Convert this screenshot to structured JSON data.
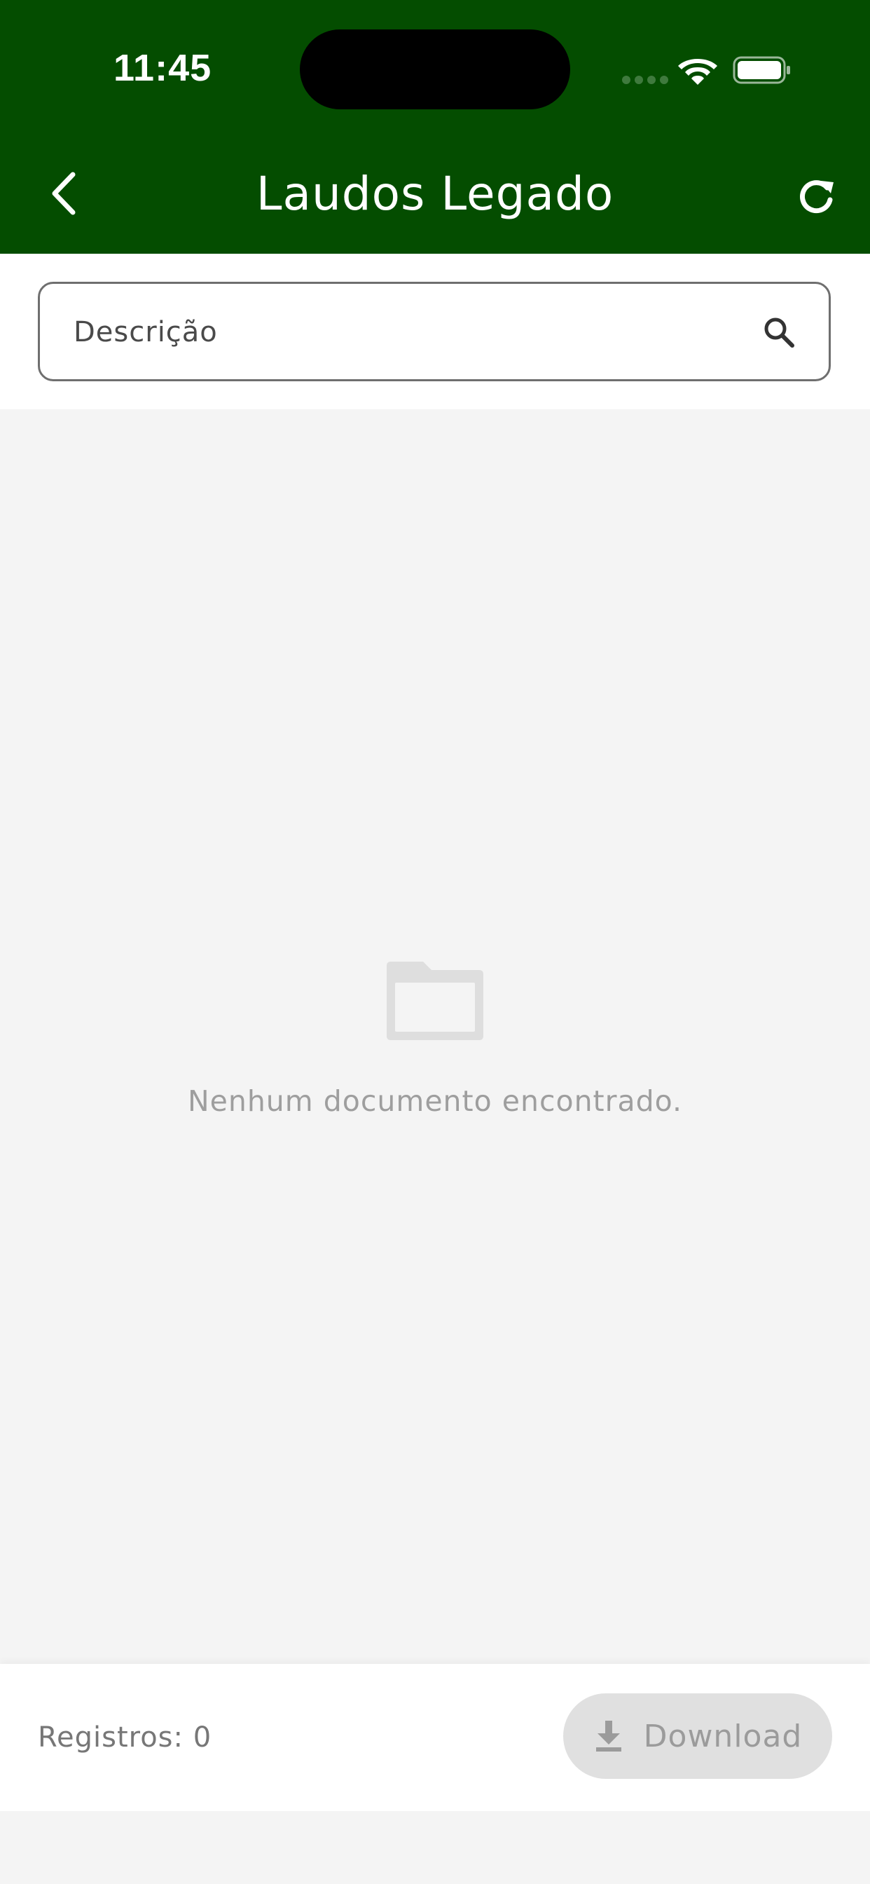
{
  "status_bar": {
    "time": "11:45",
    "icons": [
      "signal-dots-icon",
      "wifi-icon",
      "battery-icon"
    ]
  },
  "header": {
    "title": "Laudos Legado",
    "back_icon": "chevron-left-icon",
    "refresh_icon": "refresh-icon"
  },
  "search": {
    "placeholder": "Descrição",
    "value": "",
    "icon": "search-icon"
  },
  "empty_state": {
    "icon": "folder-icon",
    "message": "Nenhum documento encontrado."
  },
  "footer": {
    "record_count": "Registros: 0",
    "download_label": "Download",
    "download_icon": "download-icon"
  },
  "colors": {
    "header_bg": "#044d00",
    "content_bg": "#f4f4f4",
    "disabled_button_bg": "#e0e0e0",
    "muted_text": "#9e9e9e"
  }
}
